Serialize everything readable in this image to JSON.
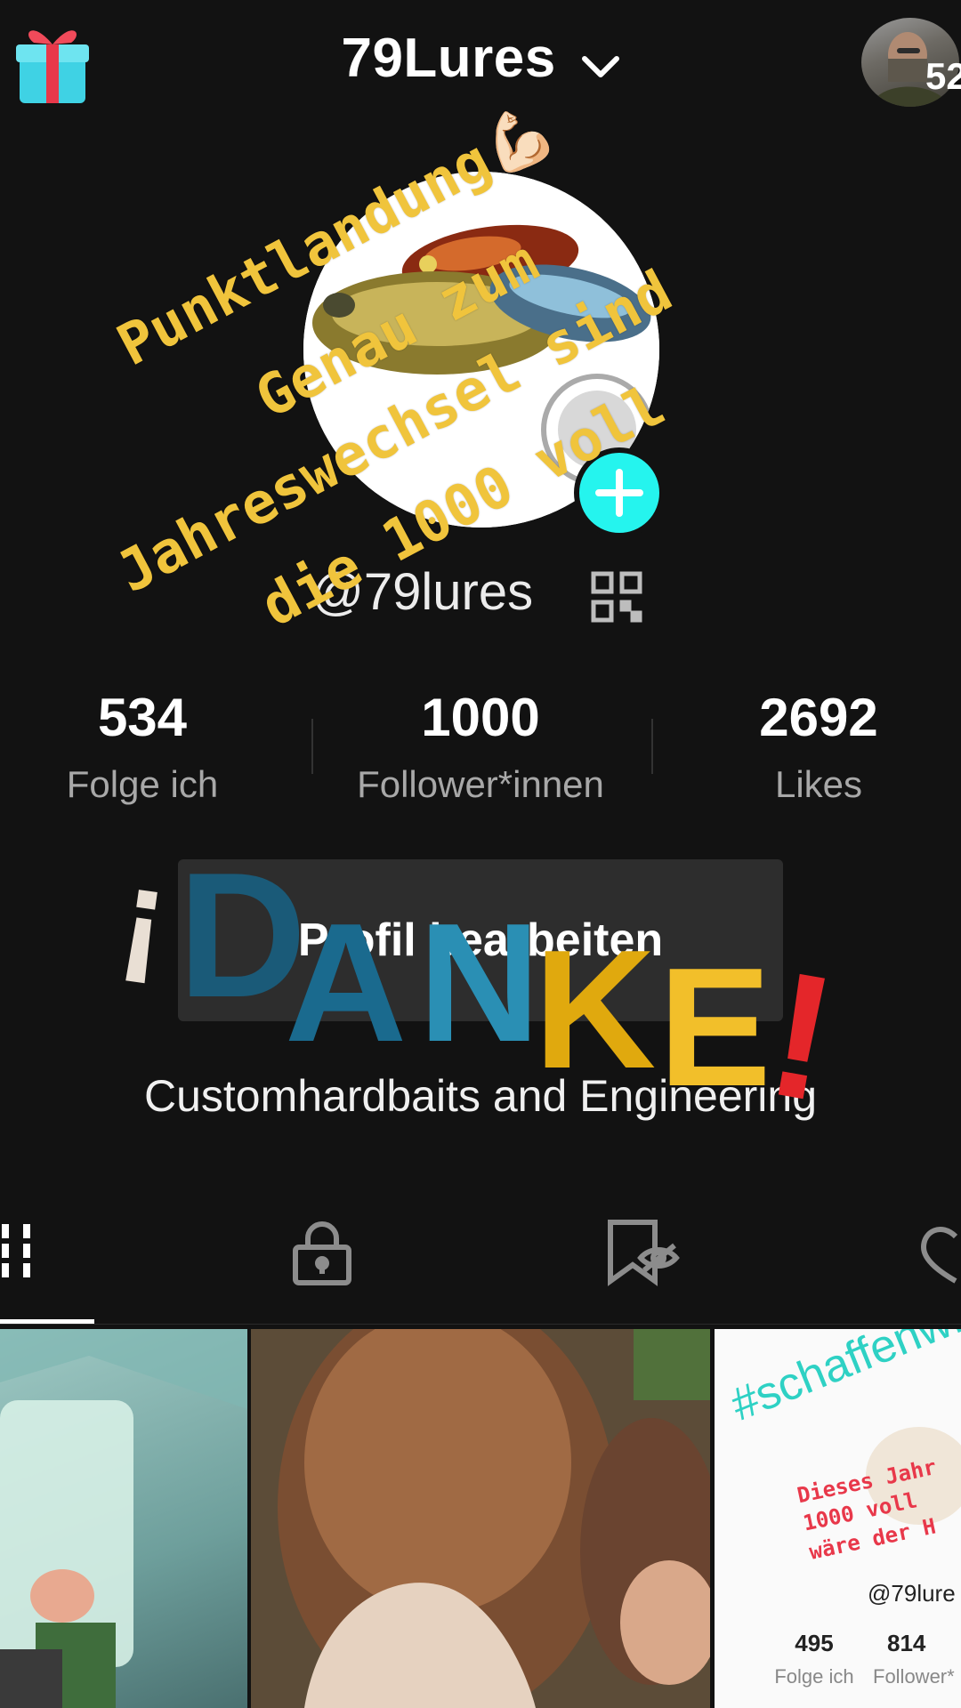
{
  "header": {
    "username": "79Lures",
    "follower_badge": "52"
  },
  "profile": {
    "handle": "@79lures",
    "stats": [
      {
        "value": "534",
        "label": "Folge ich"
      },
      {
        "value": "1000",
        "label": "Follower*innen"
      },
      {
        "value": "2692",
        "label": "Likes"
      }
    ],
    "edit_button": "Profil bearbeiten",
    "bio": "Customhardbaits and Engineering"
  },
  "overlay": {
    "line1": "Punktlandung💪🏻",
    "line2": "Genau zum",
    "line3": "Jahreswechsel sind",
    "line4": "die 1000 voll",
    "danke_text": "¡DANKE!",
    "danke_colors": [
      "#1a5a78",
      "#1a6a8e",
      "#2a8fb4",
      "#e0a90e",
      "#f2bf2a",
      "#e4262a"
    ]
  },
  "tabs": [
    "videos-grid",
    "private-lock",
    "saved-hidden",
    "liked"
  ],
  "grid": {
    "tile3": {
      "hashtag": "#schaffenwir",
      "line1": "Dieses Jahr",
      "line2": "1000 voll",
      "line3": "wäre der H",
      "handle": "@79lure",
      "stat1_value": "495",
      "stat1_label": "Folge ich",
      "stat2_value": "814",
      "stat2_label": "Follower*"
    }
  }
}
